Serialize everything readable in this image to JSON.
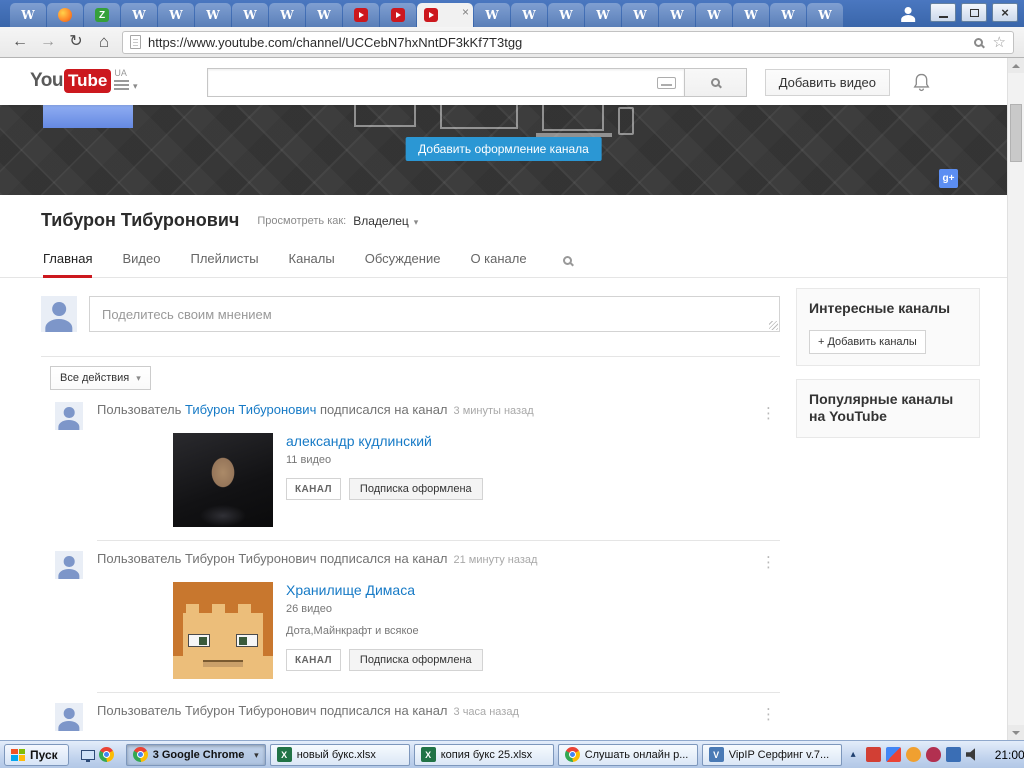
{
  "browser": {
    "address_url": "https://www.youtube.com/channel/UCCebN7hxNntDF3kKf7T3tgg",
    "tabs": [
      {
        "favicon": "wiki"
      },
      {
        "favicon": "firefox"
      },
      {
        "favicon": "zona"
      },
      {
        "favicon": "wiki"
      },
      {
        "favicon": "wiki"
      },
      {
        "favicon": "wiki"
      },
      {
        "favicon": "wiki"
      },
      {
        "favicon": "wiki"
      },
      {
        "favicon": "wiki"
      },
      {
        "favicon": "youtube"
      },
      {
        "favicon": "youtube"
      },
      {
        "favicon": "youtube",
        "active": true,
        "closable": true
      },
      {
        "favicon": "wiki"
      },
      {
        "favicon": "wiki"
      },
      {
        "favicon": "wiki"
      },
      {
        "favicon": "wiki"
      },
      {
        "favicon": "wiki"
      },
      {
        "favicon": "wiki"
      },
      {
        "favicon": "wiki"
      },
      {
        "favicon": "wiki"
      },
      {
        "favicon": "wiki"
      },
      {
        "favicon": "wiki"
      }
    ]
  },
  "yt_header": {
    "logo_you": "You",
    "logo_tube": "Tube",
    "region": "UA",
    "upload_label": "Добавить видео"
  },
  "banner": {
    "add_art_label": "Добавить оформление канала"
  },
  "channel": {
    "name": "Тибурон Тибуронович",
    "view_as_label": "Просмотреть как:",
    "view_as_value": "Владелец",
    "nav_tabs": [
      {
        "label": "Главная",
        "active": true
      },
      {
        "label": "Видео"
      },
      {
        "label": "Плейлисты"
      },
      {
        "label": "Каналы"
      },
      {
        "label": "Обсуждение"
      },
      {
        "label": "О канале"
      }
    ]
  },
  "compose": {
    "placeholder": "Поделитесь своим мнением"
  },
  "filter_label": "Все действия",
  "feed": {
    "items": [
      {
        "prefix": "Пользователь",
        "actor": "Тибурон Тибуронович",
        "actor_link": true,
        "action": "подписался на канал",
        "time": "3 минуты назад",
        "card": {
          "title": "александр кудлинский",
          "meta": "11 видео",
          "desc": "",
          "channel_button": "КАНАЛ",
          "subscribed_button": "Подписка оформлена",
          "thumb": "photo-portrait"
        }
      },
      {
        "prefix": "Пользователь",
        "actor": "Тибурон Тибуронович",
        "actor_link": false,
        "action": "подписался на канал",
        "time": "21 минуту назад",
        "card": {
          "title": "Хранилище Димаса",
          "meta": "26 видео",
          "desc": "Дота,Майнкрафт и всякое",
          "channel_button": "КАНАЛ",
          "subscribed_button": "Подписка оформлена",
          "thumb": "minecraft-avatar"
        }
      },
      {
        "prefix": "Пользователь",
        "actor": "Тибурон Тибуронович",
        "actor_link": false,
        "action": "подписался на канал",
        "time": "3 часа назад",
        "card": null
      }
    ]
  },
  "sidebar": {
    "related_title": "Интересные каналы",
    "add_button": "+ Добавить каналы",
    "popular_title": "Популярные каналы на YouTube"
  },
  "taskbar": {
    "start_label": "Пуск",
    "buttons": [
      {
        "icon": "chrome",
        "label": "3 Google Chrome",
        "active": true,
        "dropdown": true
      },
      {
        "icon": "excel",
        "label": "новый букс.xlsx"
      },
      {
        "icon": "excel",
        "label": "копия букс 25.xlsx"
      },
      {
        "icon": "chrome",
        "label": "Слушать онлайн р..."
      },
      {
        "icon": "vipip",
        "label": "VipIP Серфинг  v.7..."
      }
    ],
    "tray_icons": [
      "hidden-icons",
      "vipip",
      "apps",
      "users",
      "shield",
      "keyboard",
      "volume"
    ],
    "clock": "21:00"
  },
  "colors": {
    "youtube_red": "#cc181e",
    "link_blue": "#167ac6",
    "banner_button_blue": "#2b97d4"
  }
}
